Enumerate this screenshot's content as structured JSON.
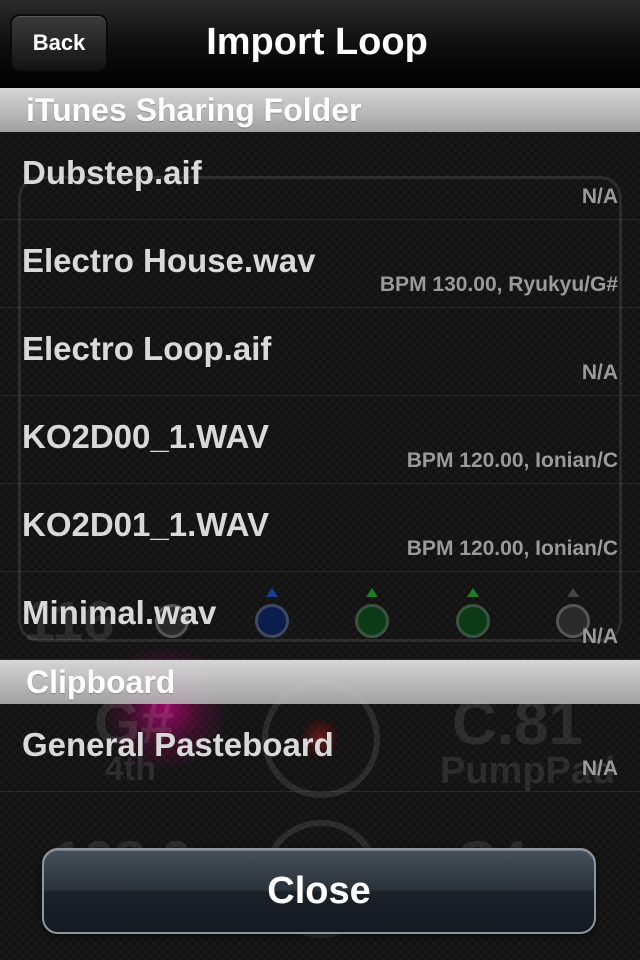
{
  "navbar": {
    "back_label": "Back",
    "title": "Import Loop"
  },
  "sections": [
    {
      "header": "iTunes Sharing Folder",
      "items": [
        {
          "name": "Dubstep.aif",
          "meta": "N/A"
        },
        {
          "name": "Electro House.wav",
          "meta": "BPM 130.00, Ryukyu/G#"
        },
        {
          "name": "Electro Loop.aif",
          "meta": "N/A"
        },
        {
          "name": "KO2D00_1.WAV",
          "meta": "BPM 120.00, Ionian/C"
        },
        {
          "name": "KO2D01_1.WAV",
          "meta": "BPM 120.00, Ionian/C"
        },
        {
          "name": "Minimal.wav",
          "meta": "N/A"
        }
      ]
    },
    {
      "header": "Clipboard",
      "items": [
        {
          "name": "General Pasteboard",
          "meta": "N/A"
        }
      ]
    }
  ],
  "background_labels": {
    "bpm_left": "116",
    "key": "G#",
    "scale": "4th",
    "big_right": "C.81",
    "preset": "PumpPad",
    "bpm_bottom": "108.0",
    "key_bottom": "C4"
  },
  "close_label": "Close"
}
